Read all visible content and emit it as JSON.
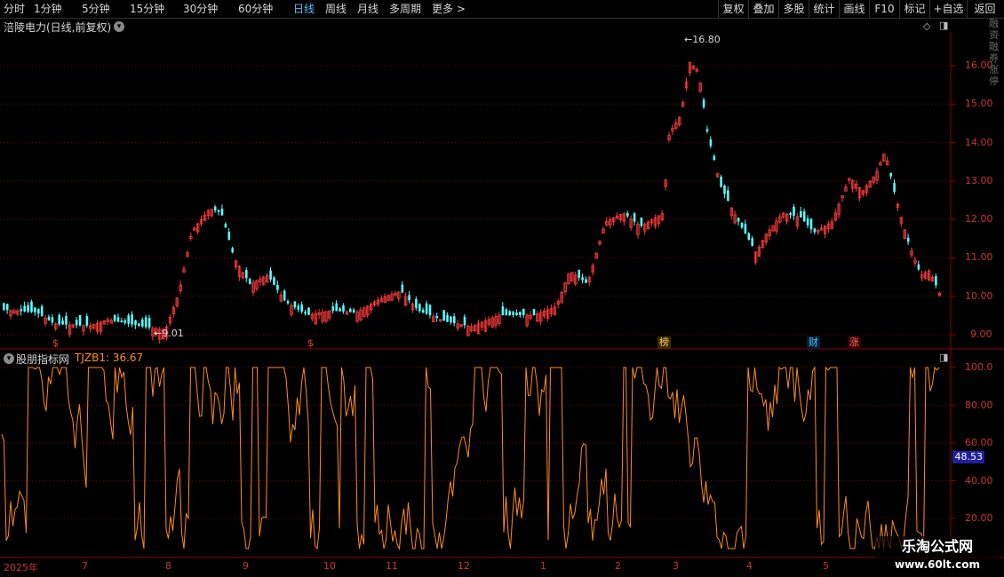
{
  "toolbar": {
    "periods": [
      "分时",
      "1分钟",
      "5分钟",
      "15分钟",
      "30分钟",
      "60分钟",
      "日线",
      "周线",
      "月线",
      "多周期",
      "更多 >"
    ],
    "active_period": "日线",
    "buttons": [
      "复权",
      "叠加",
      "多股",
      "统计",
      "画线",
      "F10",
      "标记",
      "+自选",
      "返回"
    ]
  },
  "main_panel": {
    "stock_name": "涪陵电力(日线,前复权)",
    "price_axis": [
      "16.00",
      "15.00",
      "14.00",
      "13.00",
      "12.00",
      "11.00",
      "10.00",
      "9.00"
    ],
    "high_label": "16.80",
    "low_label": "9.01",
    "markers": [
      {
        "text": "$",
        "color": "#ff3b3b"
      },
      {
        "text": "$",
        "color": "#ff3b3b"
      },
      {
        "text": "榜",
        "color": "#ffcc66"
      },
      {
        "text": "财",
        "color": "#4fc3f7"
      },
      {
        "text": "涨",
        "color": "#ff6666"
      }
    ],
    "colors": {
      "up": "#ff3b3b",
      "down": "#54ffff",
      "grid": "#7a0000"
    }
  },
  "indicator_panel": {
    "title": "股朋指标网",
    "series_label": "TJZB1: 36.67",
    "axis": [
      "100.0",
      "80.00",
      "60.00",
      "40.00",
      "20.00"
    ],
    "current_value": "48.53",
    "line_color": "#ff8c1a"
  },
  "time_axis": [
    "2025年",
    "7",
    "8",
    "9",
    "10",
    "11",
    "12",
    "1",
    "2",
    "3",
    "4",
    "5"
  ],
  "watermark": {
    "line1": "乐淘公式网",
    "line2": "www.60lt.com"
  },
  "right_strip_text": "融资融券涨停"
}
